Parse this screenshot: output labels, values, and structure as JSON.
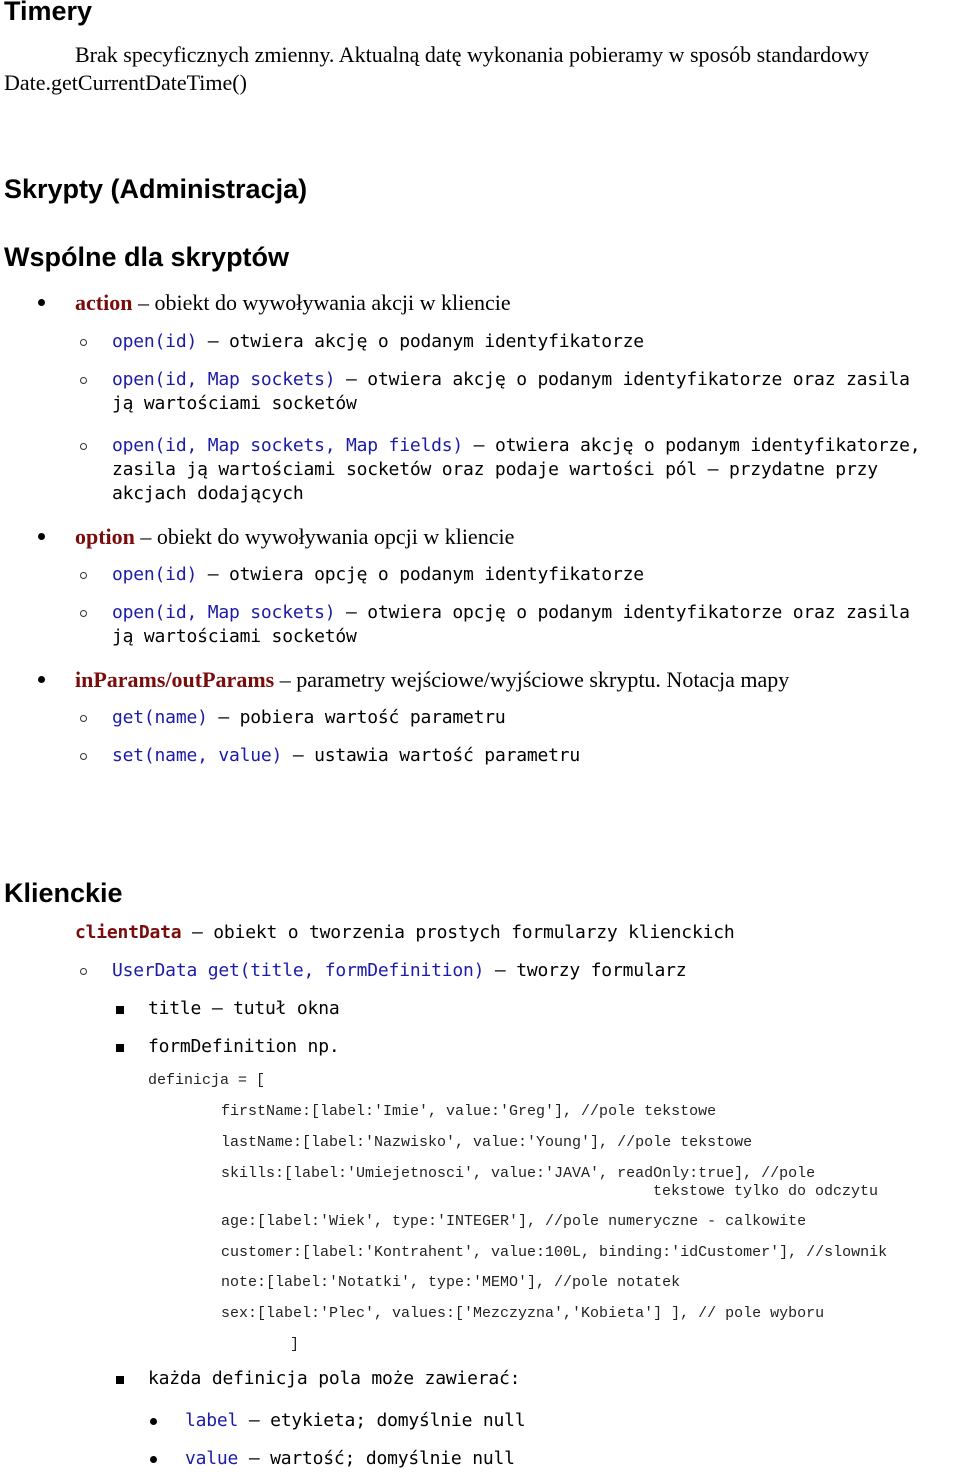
{
  "sections": {
    "timery": {
      "heading": "Timery",
      "para_line1": "Brak specyficznych zmienny. Aktualną datę wykonania pobieramy w sposób standardowy",
      "para_line2": "Date.getCurrentDateTime()"
    },
    "skrypty": {
      "heading": "Skrypty (Administracja)"
    },
    "wspolne": {
      "heading": "Wspólne dla skryptów",
      "items": [
        {
          "name": "action",
          "desc": " – obiekt do wywoływania akcji w kliencie",
          "methods": [
            {
              "sig": "open(id)",
              "desc_lines": [
                " – otwiera akcję o podanym identyfikatorze"
              ]
            },
            {
              "sig": "open(id, Map sockets)",
              "desc_lines": [
                " – otwiera akcję o podanym identyfikatorze oraz zasila",
                "ją wartościami socketów"
              ]
            },
            {
              "sig": "open(id, Map sockets, Map fields)",
              "desc_lines": [
                " – otwiera akcję o podanym identyfikatorze,",
                "zasila ją wartościami socketów oraz podaje wartości pól – przydatne przy",
                "akcjach dodających"
              ]
            }
          ]
        },
        {
          "name": "option",
          "desc": " – obiekt do wywoływania opcji w kliencie",
          "methods": [
            {
              "sig": "open(id)",
              "desc_lines": [
                " – otwiera opcję o podanym identyfikatorze"
              ]
            },
            {
              "sig": "open(id, Map sockets)",
              "desc_lines": [
                " – otwiera opcję o podanym identyfikatorze oraz zasila",
                "ją wartościami socketów"
              ]
            }
          ]
        },
        {
          "name": "inParams/outParams",
          "desc": " – parametry wejściowe/wyjściowe skryptu. Notacja mapy",
          "methods": [
            {
              "sig": "get(name)",
              "desc_lines": [
                " – pobiera wartość parametru"
              ]
            },
            {
              "sig": "set(name, value)",
              "desc_lines": [
                " – ustawia wartość parametru"
              ]
            }
          ]
        }
      ]
    },
    "klienckie": {
      "heading": "Klienckie",
      "object_name": "clientData",
      "object_desc": " – obiekt o tworzenia prostych formularzy klienckich",
      "method_sig": "UserData get(title, formDefinition)",
      "method_desc": " – tworzy formularz",
      "params": [
        {
          "text": "title – tutuł okna"
        },
        {
          "text": "formDefinition np."
        }
      ],
      "code_open": "definicja = [",
      "code_lines": [
        "firstName:[label:'Imie', value:'Greg'], //pole tekstowe",
        "lastName:[label:'Nazwisko', value:'Young'], //pole tekstowe",
        "skills:[label:'Umiejetnosci', value:'JAVA', readOnly:true], //pole",
        "tekstowe tylko do odczytu",
        "age:[label:'Wiek', type:'INTEGER'], //pole numeryczne - calkowite",
        "customer:[label:'Kontrahent', value:100L, binding:'idCustomer'], //slownik",
        "note:[label:'Notatki', type:'MEMO'], //pole notatek",
        "sex:[label:'Plec', values:['Mezczyzna','Kobieta'] ], // pole wyboru"
      ],
      "code_close": "]",
      "field_def_intro": "każda definicja pola może zawierać:",
      "field_props": [
        {
          "name": "label",
          "desc": " – etykieta; domyślnie null"
        },
        {
          "name": "value",
          "desc": " – wartość; domyślnie null"
        }
      ]
    }
  }
}
